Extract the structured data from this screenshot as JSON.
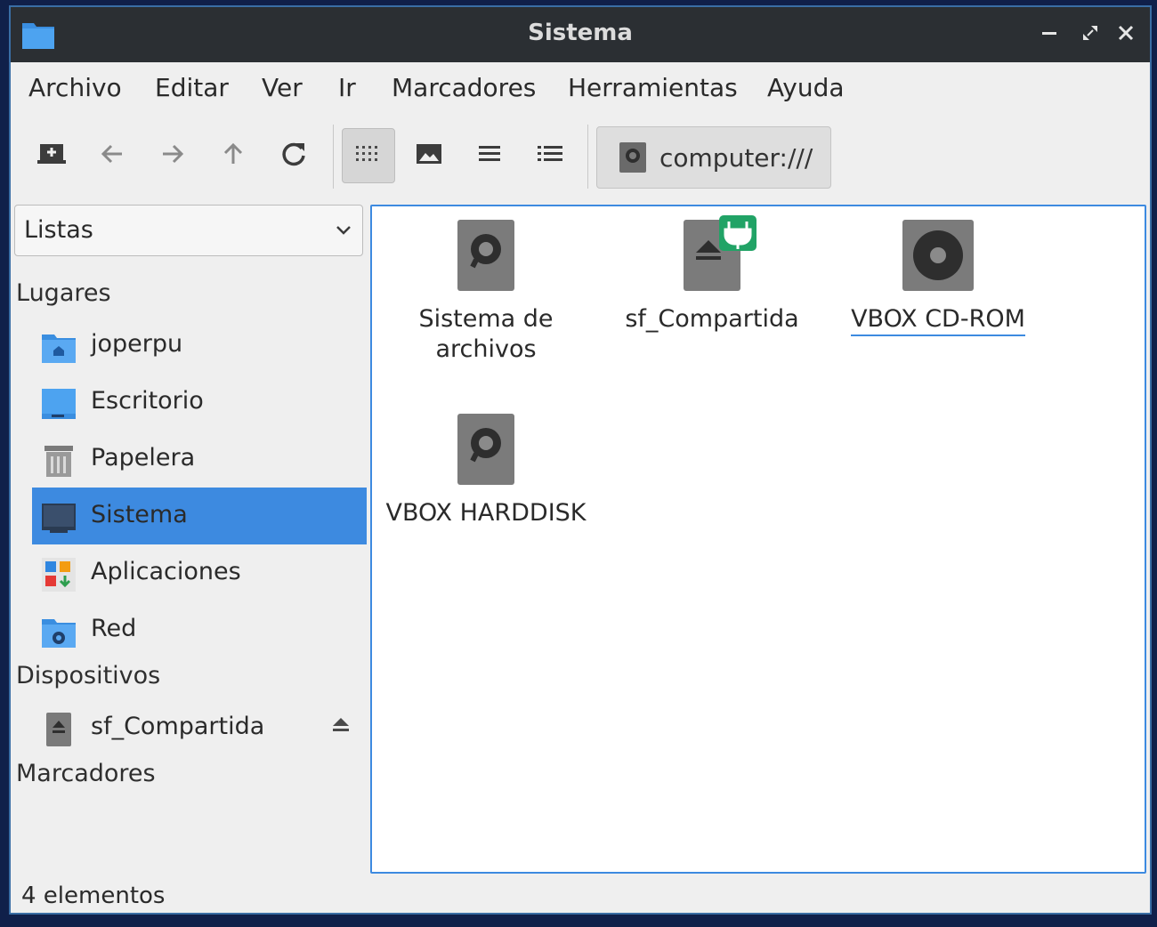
{
  "window": {
    "title": "Sistema",
    "accent_color": "#3d8ae0"
  },
  "menu": [
    "Archivo",
    "Editar",
    "Ver",
    "Ir",
    "Marcadores",
    "Herramientas",
    "Ayuda"
  ],
  "toolbar": {
    "location": "computer:///",
    "view_modes": [
      "icon-view",
      "thumbnail-view",
      "compact-view",
      "detailed-list-view"
    ],
    "active_view": "icon-view"
  },
  "sidebar": {
    "selector_value": "Listas",
    "sections": {
      "places": "Lugares",
      "devices": "Dispositivos",
      "bookmarks": "Marcadores"
    },
    "places": [
      {
        "label": "joperpu",
        "icon": "home-folder-icon"
      },
      {
        "label": "Escritorio",
        "icon": "desktop-icon"
      },
      {
        "label": "Papelera",
        "icon": "trash-icon"
      },
      {
        "label": "Sistema",
        "icon": "computer-icon",
        "selected": true
      },
      {
        "label": "Aplicaciones",
        "icon": "applications-icon"
      },
      {
        "label": "Red",
        "icon": "network-folder-icon"
      }
    ],
    "devices": [
      {
        "label": "sf_Compartida",
        "icon": "removable-drive-icon"
      }
    ]
  },
  "files": [
    {
      "label": "Sistema de archivos",
      "icon": "harddisk-icon"
    },
    {
      "label": "sf_Compartida",
      "icon": "mounted-removable-icon"
    },
    {
      "label": "VBOX CD-ROM",
      "icon": "cdrom-icon"
    },
    {
      "label": "VBOX HARDDISK",
      "icon": "harddisk-icon"
    }
  ],
  "status": "4 elementos"
}
